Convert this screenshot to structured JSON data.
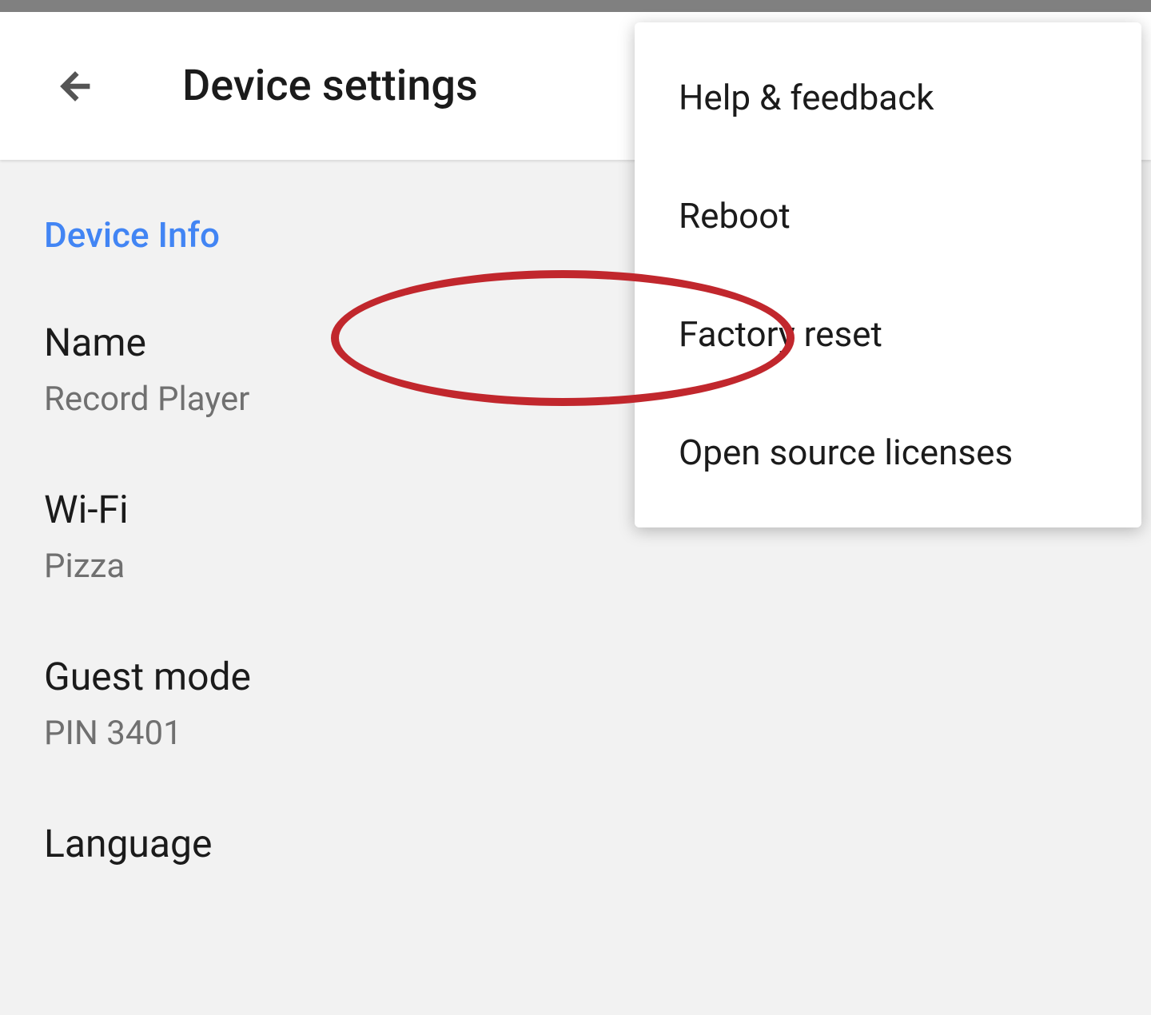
{
  "header": {
    "title": "Device settings"
  },
  "section": {
    "title": "Device Info"
  },
  "settings": {
    "name": {
      "label": "Name",
      "value": "Record Player"
    },
    "wifi": {
      "label": "Wi-Fi",
      "value": "Pizza"
    },
    "guest_mode": {
      "label": "Guest mode",
      "value": "PIN 3401"
    },
    "language": {
      "label": "Language"
    }
  },
  "menu": {
    "help_feedback": "Help & feedback",
    "reboot": "Reboot",
    "factory_reset": "Factory reset",
    "open_source": "Open source licenses"
  }
}
